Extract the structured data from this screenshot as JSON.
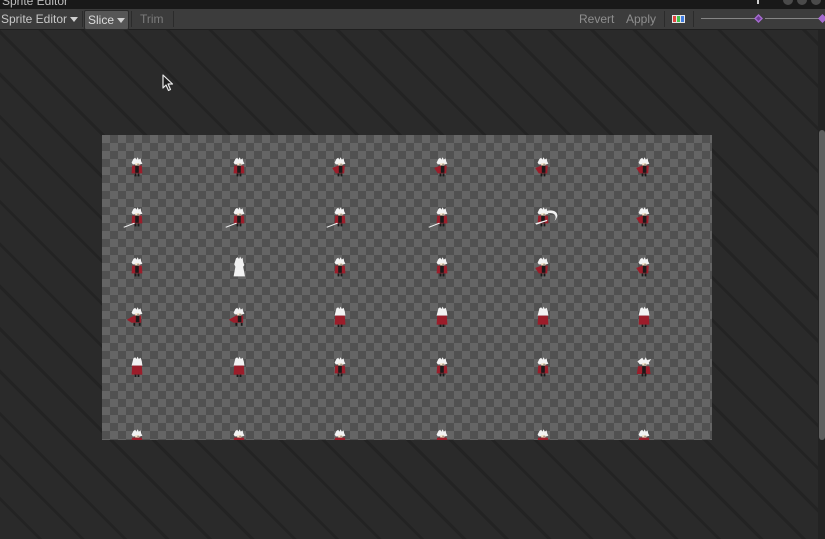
{
  "window": {
    "title": "Sprite Editor"
  },
  "toolbar": {
    "sprite_editor_label": "Sprite Editor",
    "slice_label": "Slice",
    "trim_label": "Trim",
    "revert_label": "Revert",
    "apply_label": "Apply",
    "zoom_level": 0.45,
    "mip_level": 1.0
  },
  "icons": {
    "menu": "kebab-menu-icon",
    "dropdown": "caret-down-icon",
    "color_channel": "rgb-channel-icon",
    "slider_thumb": "diamond-thumb-icon",
    "cursor": "mouse-pointer-icon"
  },
  "colors": {
    "toolbar_bg": "#3c3c3c",
    "canvas_bg": "#2a2a2a",
    "checker_light": "#656565",
    "checker_dark": "#515151",
    "character_hair": "#f2f2f2",
    "character_cloak": "#9b1d2a",
    "character_body": "#1a1a1a",
    "slider_thumb": "#a56bd0"
  },
  "sprite_sheet": {
    "columns": 6,
    "rows": 6,
    "frames": [
      [
        "idle",
        "idle",
        "walk",
        "walk",
        "walk",
        "walk"
      ],
      [
        "attack",
        "attack",
        "attack",
        "attack",
        "slash",
        "walk"
      ],
      [
        "idle",
        "silhouette",
        "idle",
        "idle",
        "walk",
        "walk"
      ],
      [
        "run",
        "run",
        "back",
        "back",
        "back",
        "back"
      ],
      [
        "back",
        "back",
        "idle",
        "idle",
        "idle",
        "hit"
      ],
      [
        "partial",
        "partial",
        "partial",
        "partial",
        "partial",
        "partial"
      ]
    ]
  }
}
